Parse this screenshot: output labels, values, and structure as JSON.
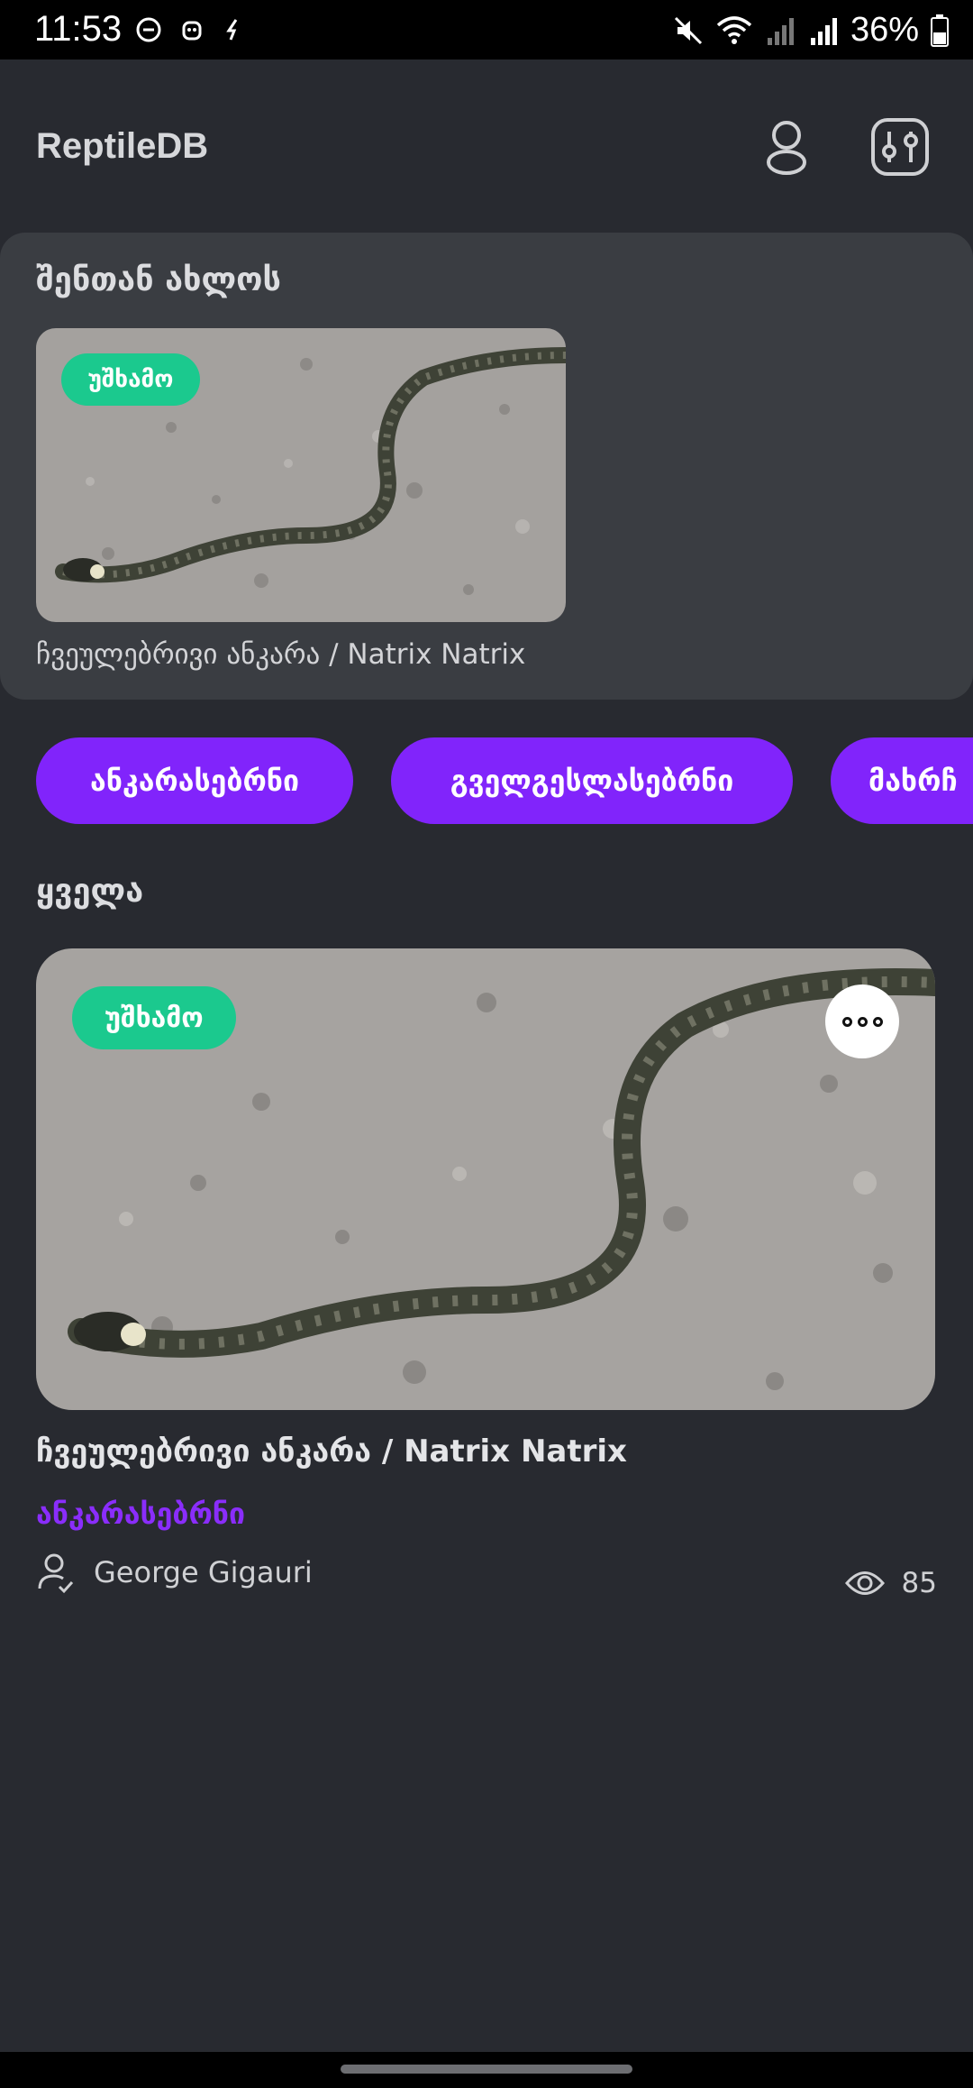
{
  "status_bar": {
    "time": "11:53",
    "battery": "36%"
  },
  "app": {
    "title": "ReptileDB"
  },
  "nearby": {
    "title": "შენთან ახლოს",
    "card": {
      "badge": "უშხამო",
      "caption": "ჩვეულებრივი ანკარა / Natrix Natrix"
    }
  },
  "categories": [
    {
      "label": "ანკარასებრნი"
    },
    {
      "label": "გველგესლასებრნი"
    },
    {
      "label": "მახრჩ"
    }
  ],
  "all": {
    "title": "ყველა",
    "card": {
      "badge": "უშხამო",
      "title": "ჩვეულებრივი ანკარა / Natrix Natrix",
      "category": "ანკარასებრნი",
      "author": "George Gigauri",
      "views": "85"
    }
  },
  "colors": {
    "background": "#282a30",
    "panel": "#3a3d42",
    "accent": "#8124fb",
    "badge": "#1bc98e"
  }
}
